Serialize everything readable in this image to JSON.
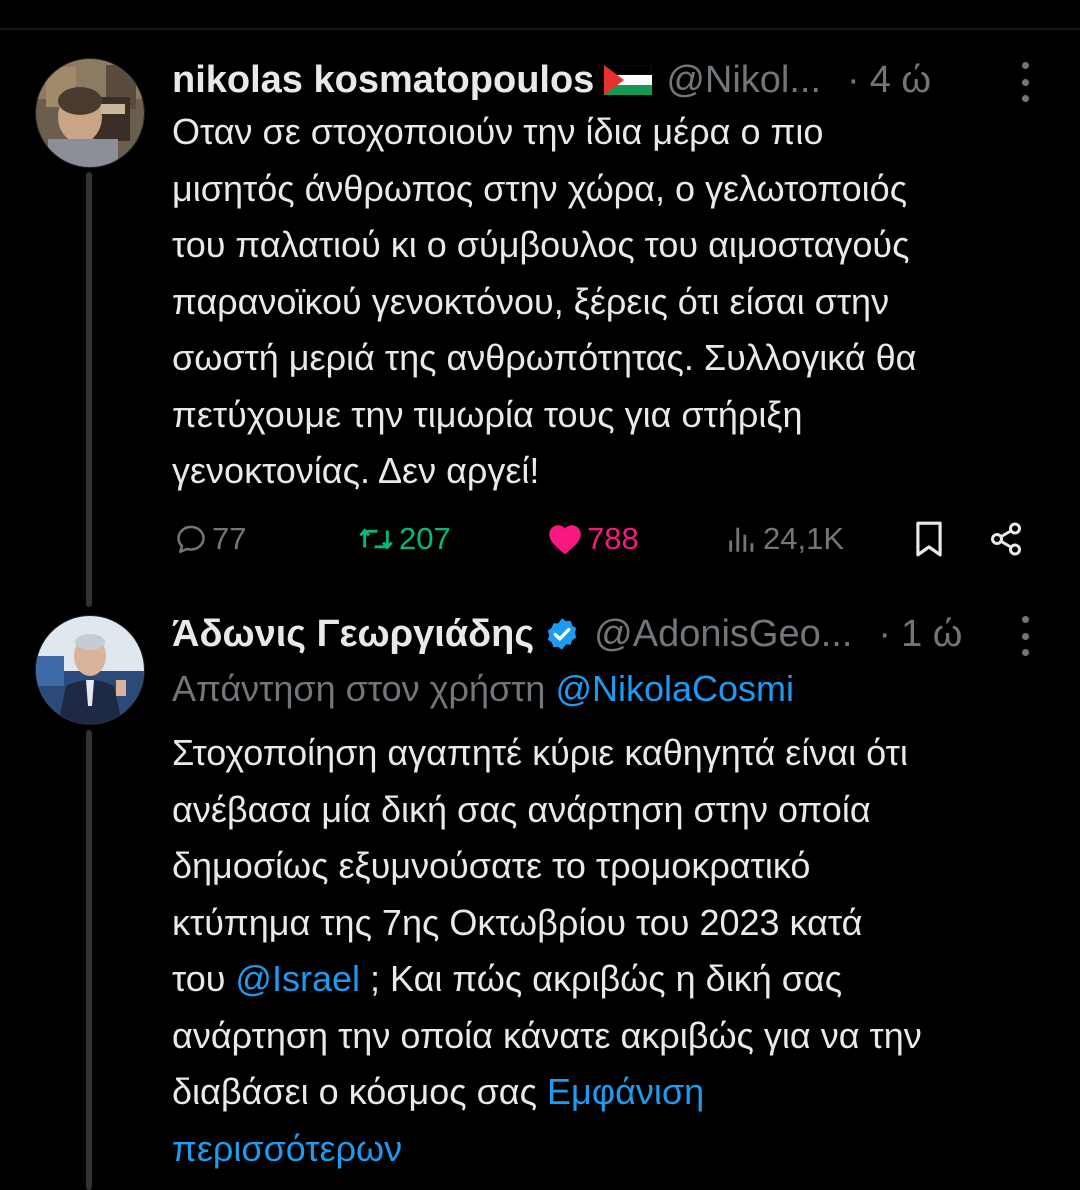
{
  "colors": {
    "background": "#000000",
    "text": "#e7e9ea",
    "muted": "#71767b",
    "link": "#1d9bf0",
    "retweet": "#00ba7c",
    "like": "#f91880",
    "verified": "#1d9bf0"
  },
  "tweets": [
    {
      "display_name": "nikolas kosmatopoulos",
      "flag_icon": "palestine-flag-icon",
      "handle": "@Nikol...",
      "separator": "·",
      "time": "4 ώ",
      "text": "Οταν σε στοχοποιούν την ίδια μέρα ο πιο\nμισητός άνθρωπος στην χώρα, ο γελωτοποιός\nτου παλατιού κι ο σύμβουλος του αιμοσταγούς\nπαρανοϊκού γενοκτόνου, ξέρεις ότι είσαι στην\nσωστή μεριά της ανθρωπότητας. Συλλογικά θα\nπετύχουμε την τιμωρία τους για στήριξη\nγενοκτονίας. Δεν αργεί!",
      "stats": {
        "replies": "77",
        "retweets": "207",
        "likes": "788",
        "views": "24,1K"
      }
    },
    {
      "display_name": "Άδωνις Γεωργιάδης",
      "verified_icon": "verified-badge-icon",
      "handle": "@AdonisGeo...",
      "separator": "·",
      "time": "1 ώ",
      "reply_prefix": "Απάντηση στον χρήστη ",
      "reply_mention": "@NikolaCosmi",
      "text_part1": "Στοχοποίηση αγαπητέ κύριε καθηγητά είναι ότι\nανέβασα μία δική σας ανάρτηση στην οποία\nδημοσίως εξυμνούσατε το τρομοκρατικό\nκτύπημα της 7ης Οκτωβρίου του 2023 κατά\nτου ",
      "text_mention": "@Israel",
      "text_part2": " ; Και πώς ακριβώς η δική σας\nανάρτηση την οποία κάνατε ακριβώς για να την\nδιαβάσει ο κόσμος σας ",
      "show_more": "Εμφάνιση\nπερισσότερων"
    }
  ]
}
